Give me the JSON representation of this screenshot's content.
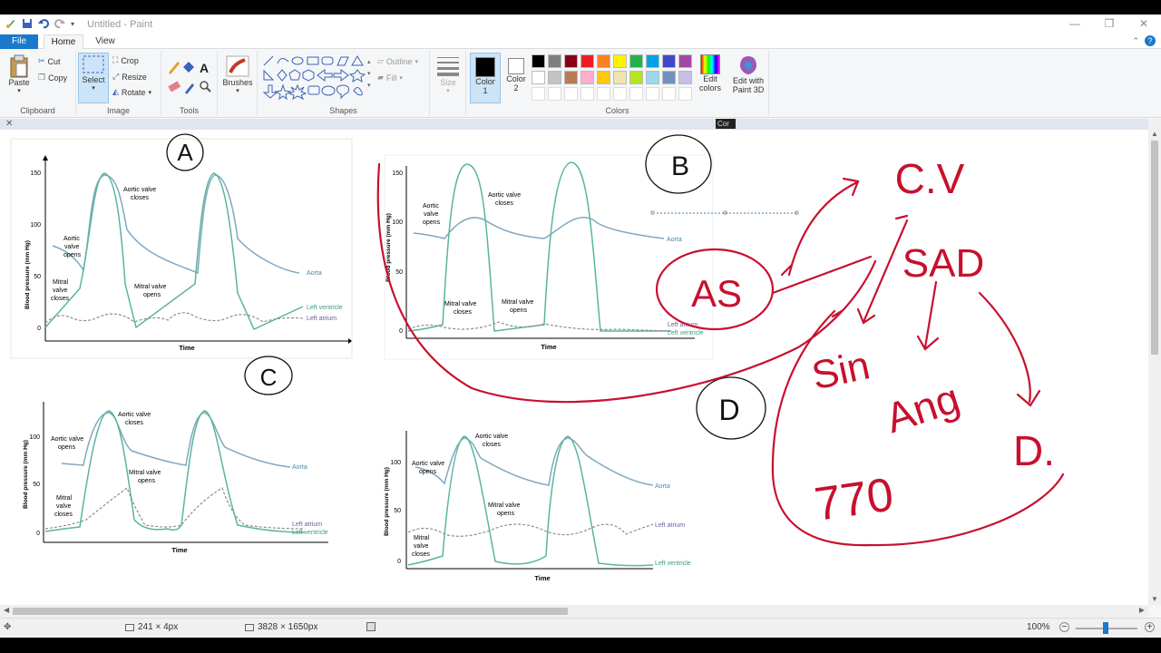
{
  "window": {
    "title": "Untitled - Paint"
  },
  "tabs": {
    "file": "File",
    "home": "Home",
    "view": "View"
  },
  "ribbon": {
    "clipboard": {
      "label": "Clipboard",
      "paste": "Paste",
      "cut": "Cut",
      "copy": "Copy"
    },
    "image": {
      "label": "Image",
      "select": "Select",
      "crop": "Crop",
      "resize": "Resize",
      "rotate": "Rotate"
    },
    "tools": {
      "label": "Tools"
    },
    "brushes": {
      "label": "Brushes"
    },
    "shapes": {
      "label": "Shapes",
      "outline": "Outline",
      "fill": "Fill"
    },
    "size": {
      "label": "Size"
    },
    "colors": {
      "label": "Colors",
      "color1": "Color",
      "color1_num": "1",
      "color2": "Color",
      "color2_num": "2",
      "edit": "Edit",
      "edit2": "colors",
      "paint3d": "Edit with",
      "paint3d2": "Paint 3D",
      "palette_row1": [
        "#000000",
        "#7f7f7f",
        "#880015",
        "#ed1c24",
        "#ff7f27",
        "#fff200",
        "#22b14c",
        "#00a2e8",
        "#3f48cc",
        "#a349a4"
      ],
      "palette_row2": [
        "#ffffff",
        "#c3c3c3",
        "#b97a57",
        "#ffaec9",
        "#ffc90e",
        "#efe4b0",
        "#b5e61d",
        "#99d9ea",
        "#7092be",
        "#c8bfe7"
      ]
    }
  },
  "canvas": {
    "popup_text": "Cor",
    "graph_a": {
      "letter": "A",
      "ylabel": "Blood pressure (mm Hg)",
      "xlabel": "Time",
      "ticks": [
        "150",
        "100",
        "50",
        "0"
      ],
      "labels": {
        "aortic_closes_1": "Aortic valve",
        "aortic_closes_2": "closes",
        "aortic_opens_1": "Aortic",
        "aortic_opens_2": "valve",
        "aortic_opens_3": "opens",
        "mitral_closes_1": "Mitral",
        "mitral_closes_2": "valve",
        "mitral_closes_3": "closes",
        "mitral_opens_1": "Mitral valve",
        "mitral_opens_2": "opens",
        "aorta": "Aorta",
        "lv": "Left ventricle",
        "la": "Left atrium"
      }
    },
    "graph_b": {
      "letter": "B",
      "ylabel": "Blood pressure (mm Hg)",
      "xlabel": "Time",
      "ticks": [
        "150",
        "100",
        "50",
        "0"
      ],
      "labels": {
        "aortic_opens_1": "Aortic",
        "aortic_opens_2": "valve",
        "aortic_opens_3": "opens",
        "aortic_closes_1": "Aortic valve",
        "aortic_closes_2": "closes",
        "mitral_closes_1": "Mitral valve",
        "mitral_closes_2": "closes",
        "mitral_opens_1": "Mitral valve",
        "mitral_opens_2": "opens",
        "aorta": "Aorta",
        "la": "Left atrium",
        "lv": "Left ventricle"
      }
    },
    "graph_c": {
      "letter": "C",
      "ylabel": "Blood pressure (mm Hg)",
      "xlabel": "Time",
      "ticks": [
        "100",
        "50",
        "0"
      ],
      "labels": {
        "aortic_closes_1": "Aortic valve",
        "aortic_closes_2": "closes",
        "aortic_opens_1": "Aortic valve",
        "aortic_opens_2": "opens",
        "mitral_opens_1": "Mitral valve",
        "mitral_opens_2": "opens",
        "mitral_closes_1": "Mitral",
        "mitral_closes_2": "valve",
        "mitral_closes_3": "closes",
        "aorta": "Aorta",
        "la": "Left atrium",
        "lv": "Left ventricle"
      }
    },
    "graph_d": {
      "letter": "D",
      "ylabel": "Blood pressure (mm Hg)",
      "xlabel": "Time",
      "ticks": [
        "100",
        "50",
        "0"
      ],
      "labels": {
        "aortic_closes_1": "Aortic valve",
        "aortic_closes_2": "closes",
        "aortic_opens_1": "Aortic valve",
        "aortic_opens_2": "opens",
        "mitral_opens_1": "Mitral valve",
        "mitral_opens_2": "opens",
        "mitral_closes_1": "Mitral",
        "mitral_closes_2": "valve",
        "mitral_closes_3": "closes",
        "aorta": "Aorta",
        "la": "Left atrium",
        "lv": "Left ventricle"
      }
    },
    "handwriting": {
      "as": "AS",
      "cv": "C.V",
      "sad": "SAD",
      "sin": "Sin",
      "ang": "Ang",
      "d": "D.",
      "n770": "770"
    }
  },
  "status": {
    "selection_size": "241 × 4px",
    "image_size": "3828 × 1650px",
    "zoom": "100%"
  }
}
